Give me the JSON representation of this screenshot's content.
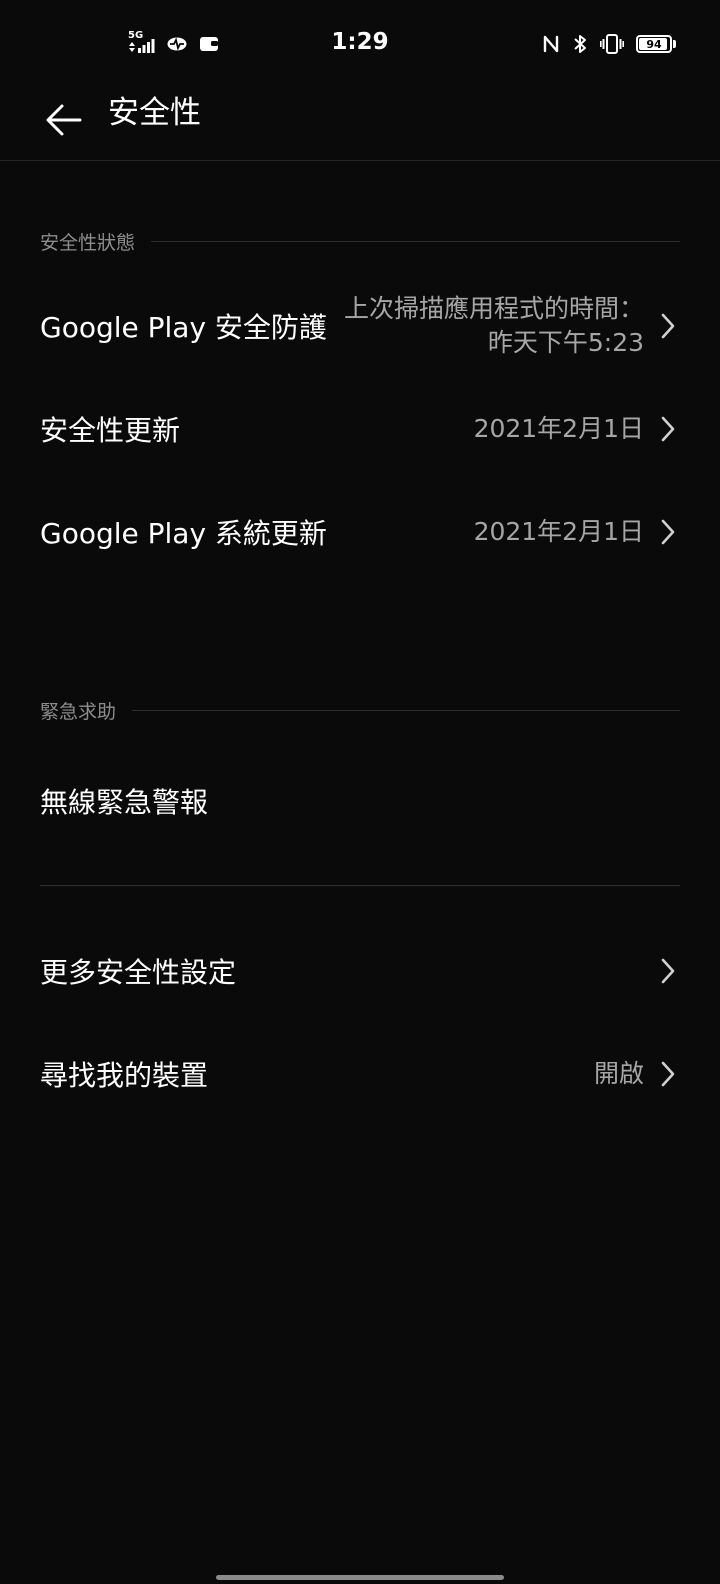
{
  "status_bar": {
    "network_label": "5G",
    "time": "1:29",
    "battery_level": "94",
    "battery_fraction": 0.94,
    "icons": [
      "signal-icon",
      "data-saver-icon",
      "wallet-icon",
      "nfc-icon",
      "bluetooth-icon",
      "vibrate-icon",
      "battery-icon"
    ]
  },
  "header": {
    "title": "安全性",
    "back_icon": "arrow-left-icon"
  },
  "sections": {
    "security_status": {
      "label": "安全性狀態",
      "items": [
        {
          "title": "Google Play 安全防護",
          "value": "上次掃描應用程式的時間：昨天下午5:23"
        },
        {
          "title": "安全性更新",
          "value": "2021年2月1日"
        },
        {
          "title": "Google Play 系統更新",
          "value": "2021年2月1日"
        }
      ]
    },
    "emergency": {
      "label": "緊急求助",
      "items": [
        {
          "title": "無線緊急警報"
        }
      ]
    },
    "more": {
      "items": [
        {
          "title": "更多安全性設定",
          "value": ""
        },
        {
          "title": "尋找我的裝置",
          "value": "開啟"
        }
      ]
    }
  },
  "colors": {
    "background": "#0a0a0a",
    "text_primary": "#ffffff",
    "text_secondary": "#a6a6a6",
    "section_label": "#8c8c8c",
    "divider": "#2e2e2e"
  }
}
